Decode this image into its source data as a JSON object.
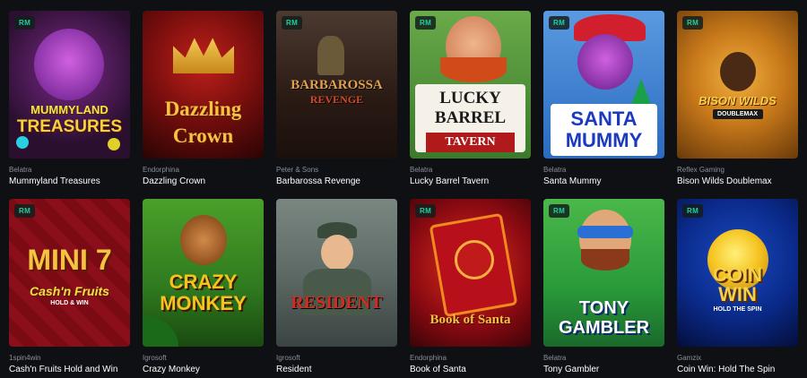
{
  "badge_label": "RM",
  "games": [
    {
      "provider": "Belatra",
      "name": "Mummyland Treasures",
      "art_text": [
        "MUMMYLAND",
        "TREASURES"
      ],
      "bg": "#2a0f2f",
      "accent": "#c43cd6",
      "has_badge": true
    },
    {
      "provider": "Endorphina",
      "name": "Dazzling Crown",
      "art_text": [
        "Dazzling",
        "Crown"
      ],
      "bg": "#6e0c0c",
      "accent": "#f7b733",
      "has_badge": false
    },
    {
      "provider": "Peter & Sons",
      "name": "Barbarossa Revenge",
      "art_text": [
        "BARBAROSSA",
        "REVENGE"
      ],
      "bg": "#3a2a22",
      "accent": "#c8823a",
      "has_badge": true
    },
    {
      "provider": "Belatra",
      "name": "Lucky Barrel Tavern",
      "art_text": [
        "LUCKY",
        "BARREL",
        "TAVERN"
      ],
      "bg": "#5a9a3a",
      "accent": "#e0452a",
      "has_badge": true
    },
    {
      "provider": "Belatra",
      "name": "Santa Mummy",
      "art_text": [
        "SANTA",
        "MUMMY"
      ],
      "bg": "#3a7fd0",
      "accent": "#d21f2d",
      "has_badge": true
    },
    {
      "provider": "Reflex Gaming",
      "name": "Bison Wilds Doublemax",
      "art_text": [
        "BISON WILDS",
        "DOUBLEMAX"
      ],
      "bg": "#c97a1a",
      "accent": "#f5d04a",
      "has_badge": true
    },
    {
      "provider": "1spin4win",
      "name": "Cash'n Fruits Hold and Win",
      "art_text": [
        "MINI 7",
        "Cash'n Fruits",
        "HOLD & WIN"
      ],
      "bg": "#8a0f1a",
      "accent": "#f5c341",
      "has_badge": true
    },
    {
      "provider": "Igrosoft",
      "name": "Crazy Monkey",
      "art_text": [
        "CRAZY",
        "MONKEY"
      ],
      "bg": "#2f7a1f",
      "accent": "#f5c21f",
      "has_badge": false
    },
    {
      "provider": "Igrosoft",
      "name": "Resident",
      "art_text": [
        "RESIDENT"
      ],
      "bg": "#5e6a66",
      "accent": "#d42a1f",
      "has_badge": false
    },
    {
      "provider": "Endorphina",
      "name": "Book of Santa",
      "art_text": [
        "Book of Santa"
      ],
      "bg": "#8a0a12",
      "accent": "#f08a20",
      "has_badge": true
    },
    {
      "provider": "Belatra",
      "name": "Tony Gambler",
      "art_text": [
        "TONY",
        "GAMBLER"
      ],
      "bg": "#2a9a3a",
      "accent": "#2a6fd4",
      "has_badge": true
    },
    {
      "provider": "Gamzix",
      "name": "Coin Win: Hold The Spin",
      "art_text": [
        "COIN",
        "WIN",
        "HOLD THE SPIN"
      ],
      "bg": "#0a2a8a",
      "accent": "#f5c21f",
      "has_badge": true
    }
  ]
}
